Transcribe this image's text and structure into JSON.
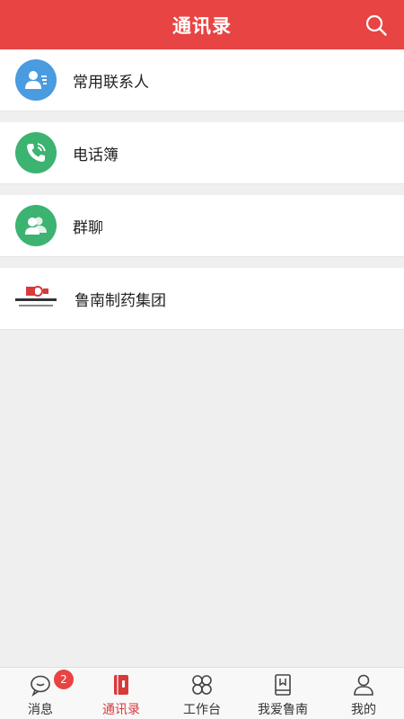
{
  "header": {
    "title": "通讯录",
    "search_icon": "search-icon",
    "bg_color": "#e74443"
  },
  "list": [
    {
      "label": "常用联系人",
      "icon": "frequent-contact-icon",
      "color": "#4a9be0"
    },
    {
      "label": "电话簿",
      "icon": "phone-book-icon",
      "color": "#3cb371"
    },
    {
      "label": "群聊",
      "icon": "group-chat-icon",
      "color": "#3cb371"
    },
    {
      "label": "鲁南制药集团",
      "icon": "lunan-logo"
    }
  ],
  "tabbar": {
    "tabs": [
      {
        "label": "消息",
        "icon": "message-icon",
        "badge": "2"
      },
      {
        "label": "通讯录",
        "icon": "contacts-icon",
        "active": true
      },
      {
        "label": "工作台",
        "icon": "workbench-icon"
      },
      {
        "label": "我爱鲁南",
        "icon": "book-icon"
      },
      {
        "label": "我的",
        "icon": "profile-icon"
      }
    ],
    "active_color": "#d83a3a"
  }
}
